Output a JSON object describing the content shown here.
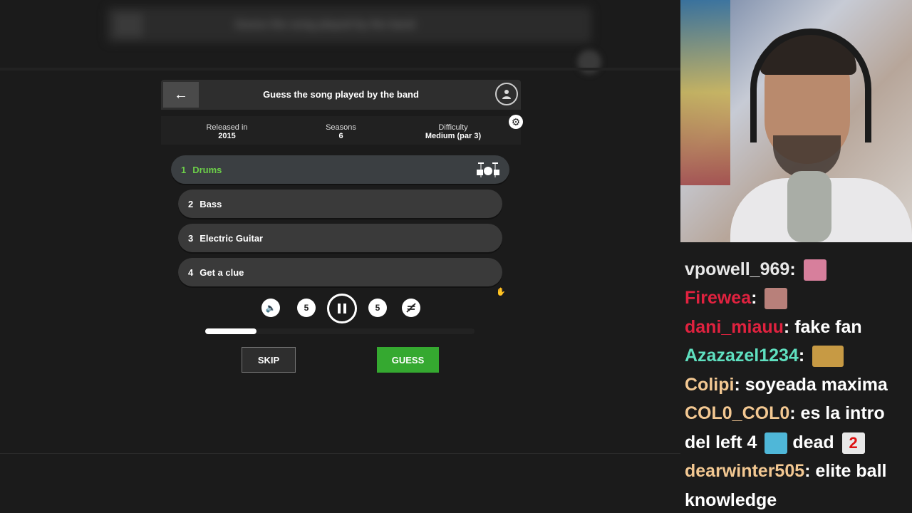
{
  "background_page": {
    "blurred_title": "Guess the song played by the band"
  },
  "game": {
    "title": "Guess the song played by the band",
    "info": [
      {
        "label": "Released in",
        "value": "2015"
      },
      {
        "label": "Seasons",
        "value": "6"
      },
      {
        "label": "Difficulty",
        "value": "Medium (par 3)"
      }
    ],
    "tracks": [
      {
        "number": "1",
        "label": "Drums",
        "active": true
      },
      {
        "number": "2",
        "label": "Bass",
        "active": false
      },
      {
        "number": "3",
        "label": "Electric Guitar",
        "active": false
      },
      {
        "number": "4",
        "label": "Get a clue",
        "active": false
      }
    ],
    "controls": {
      "rewind_seconds": "5",
      "forward_seconds": "5"
    },
    "progress_fraction": 0.19,
    "skip_label": "SKIP",
    "guess_label": "GUESS",
    "colors": {
      "active_track": "#6ccf49",
      "guess_button": "#35a930"
    }
  },
  "chat": {
    "messages": [
      {
        "user": "vpowell_969",
        "text": "",
        "user_color": "#e8e8e8",
        "emotes": [
          "pink-emote"
        ]
      },
      {
        "user": "Firewea",
        "text": "",
        "user_color": "#e0223f",
        "emotes": [
          "face-emote"
        ]
      },
      {
        "user": "dani_miauu",
        "text": "fake fan",
        "user_color": "#e0223f",
        "emotes": []
      },
      {
        "user": "Azazazel1234",
        "text": "",
        "user_color": "#5fe0c0",
        "emotes": [
          "hood-emote"
        ]
      },
      {
        "user": "Colipi",
        "text": "soyeada maxima",
        "user_color": "#f3c892",
        "emotes": []
      },
      {
        "user": "COL0_COL0",
        "text": "es la intro del left 4",
        "after_emote_text": "dead",
        "user_color": "#f3c892",
        "emotes": [
          "blue-emote",
          "number-two-emote"
        ]
      },
      {
        "user": "dearwinter505",
        "text": "elite ball knowledge",
        "user_color": "#f3c892",
        "emotes": []
      }
    ]
  }
}
